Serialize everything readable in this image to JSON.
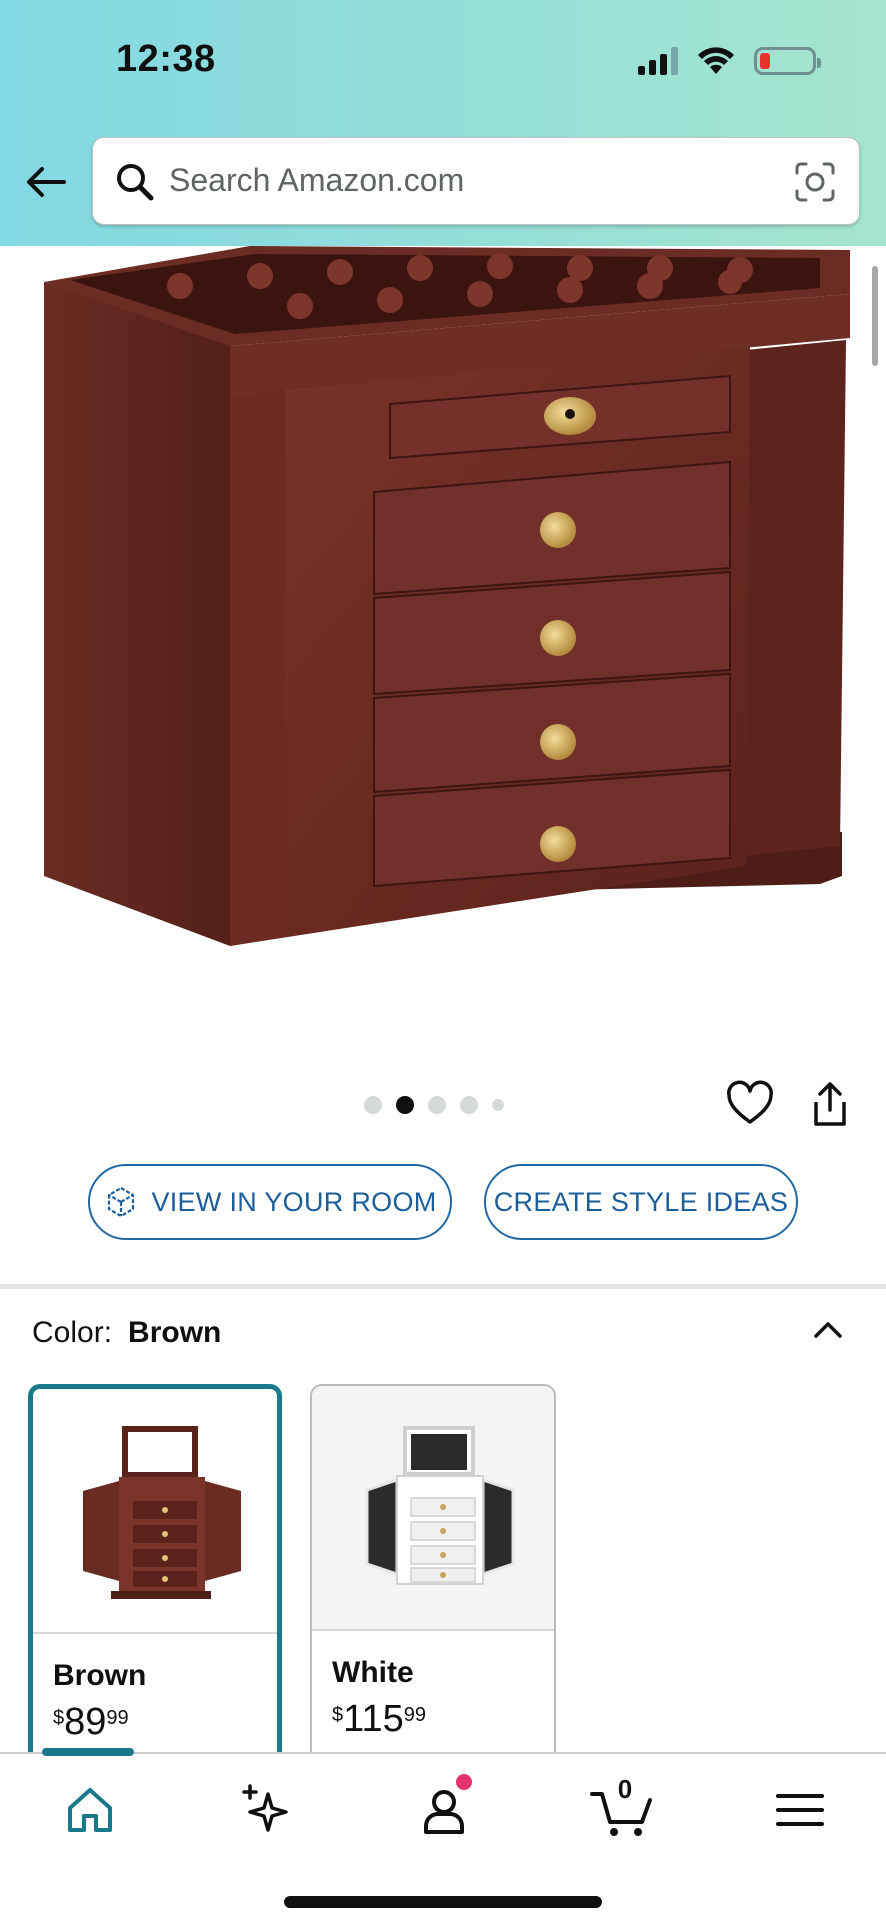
{
  "status_bar": {
    "time": "12:38"
  },
  "search": {
    "placeholder": "Search Amazon.com"
  },
  "carousel": {
    "count": 5,
    "active_index": 1
  },
  "actions": {
    "view_in_room": "VIEW IN YOUR ROOM",
    "create_style_ideas": "CREATE STYLE IDEAS"
  },
  "variation": {
    "label": "Color:",
    "selected": "Brown",
    "options": [
      {
        "name": "Brown",
        "currency": "$",
        "price_whole": "89",
        "price_fraction": "99"
      },
      {
        "name": "White",
        "currency": "$",
        "price_whole": "115",
        "price_fraction": "99"
      }
    ]
  },
  "bottom_nav": {
    "items": [
      "home",
      "ai-sparkle",
      "account",
      "cart",
      "menu"
    ],
    "cart_count": "0"
  },
  "colors": {
    "accent": "#1a7a8b",
    "link": "#1b5e99",
    "badge": "#e5336d"
  }
}
